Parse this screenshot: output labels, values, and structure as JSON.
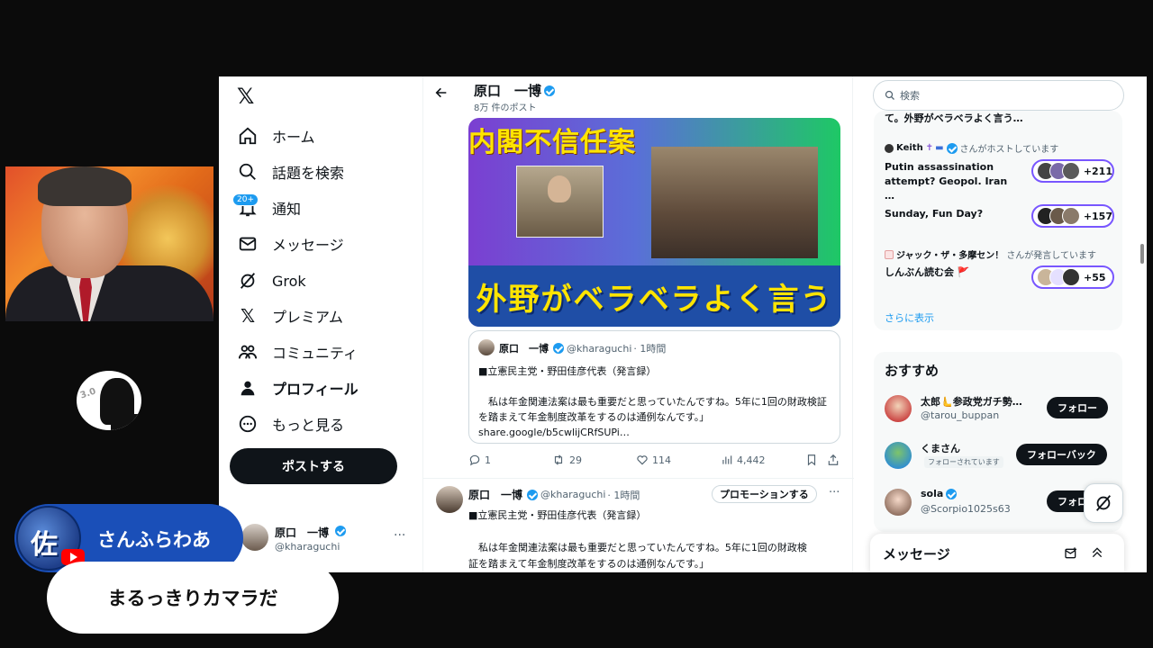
{
  "nav": {
    "items": [
      {
        "label": "ホーム",
        "icon": "home-icon"
      },
      {
        "label": "話題を検索",
        "icon": "search-icon"
      },
      {
        "label": "通知",
        "icon": "bell-icon",
        "badge": "20+"
      },
      {
        "label": "メッセージ",
        "icon": "mail-icon"
      },
      {
        "label": "Grok",
        "icon": "grok-icon"
      },
      {
        "label": "プレミアム",
        "icon": "x-premium-icon"
      },
      {
        "label": "コミュニティ",
        "icon": "community-icon"
      },
      {
        "label": "プロフィール",
        "icon": "profile-icon"
      },
      {
        "label": "もっと見る",
        "icon": "more-circle-icon"
      }
    ],
    "post_button": "ポストする",
    "account": {
      "name": "原口　一博",
      "handle": "@kharaguchi"
    }
  },
  "timeline": {
    "title": "原口　一博",
    "post_count": "8万 件のポスト",
    "thumbnail": {
      "top_text": "内閣不信任案",
      "bottom_text": "外野がベラベラよく言う"
    },
    "quote": {
      "name": "原口　一博",
      "handle": "@kharaguchi",
      "time": "· 1時間",
      "body": "■立憲民主党・野田佳彦代表（発言録）\n\n　私は年金関連法案は最も重要だと思っていたんですね。5年に1回の財政検証を踏まえて年金制度改革をするのは通例なんです。」\nshare.google/b5cwlijCRfSUPi…"
    },
    "actions": {
      "replies": "1",
      "reposts": "29",
      "likes": "114",
      "views": "4,442"
    },
    "post2": {
      "name": "原口　一博",
      "handle": "@kharaguchi",
      "time": "· 1時間",
      "promo": "プロモーションする",
      "body": "■立憲民主党・野田佳彦代表（発言録）\n\n　私は年金関連法案は最も重要だと思っていたんですね。5年に1回の財政検\n証を踏まえて年金制度改革をするのは通例なんです。」"
    }
  },
  "right": {
    "search_placeholder": "検索",
    "spaces": {
      "cut_title": "て。外野がベラベラよく言う…",
      "items": [
        {
          "host_name": "Keith",
          "host_suffix": "さんがホストしています",
          "title": "Putin assassination attempt? Geopol. Iran …",
          "count": "+211"
        },
        {
          "host_name": "",
          "host_suffix": "",
          "title": "Sunday, Fun Day?",
          "count": "+157"
        },
        {
          "host_name": "ジャック・ザ・多摩セン！",
          "host_suffix": "さんが発言しています",
          "title": "しんぶん読む会 🚩",
          "count": "+55"
        }
      ],
      "more": "さらに表示"
    },
    "recommend": {
      "title": "おすすめ",
      "items": [
        {
          "name": "太郎🫷参政党ガチ勢…",
          "handle": "@tarou_buppan",
          "button": "フォロー",
          "follows_you": ""
        },
        {
          "name": "くまさん",
          "handle": "",
          "button": "フォローバック",
          "follows_you": "フォローされています"
        },
        {
          "name": "sola",
          "handle": "@Scorpio1025s63",
          "button": "フォロ",
          "follows_you": ""
        }
      ]
    },
    "messages_title": "メッセージ"
  },
  "chat": {
    "name": "さんふらわあ",
    "avatar_text": "佐",
    "message": "まるっきりカマラだ"
  }
}
